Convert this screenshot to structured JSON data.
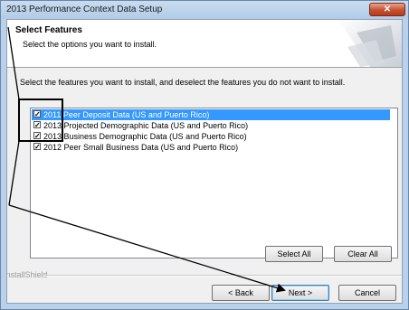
{
  "window": {
    "title": "2013 Performance Context Data Setup",
    "close_glyph": "✕"
  },
  "header": {
    "title": "Select Features",
    "subtitle": "Select the options you want to install."
  },
  "instructions": "Select the features you want to install, and deselect the features you do not want to install.",
  "features": [
    {
      "label": "2011 Peer Deposit Data (US and Puerto Rico)",
      "checked": true,
      "selected": true
    },
    {
      "label": "2013 Projected Demographic Data (US and Puerto Rico)",
      "checked": true,
      "selected": false
    },
    {
      "label": "2013 Business Demographic Data (US and Puerto Rico)",
      "checked": true,
      "selected": false
    },
    {
      "label": "2012 Peer Small Business Data (US and Puerto Rico)",
      "checked": true,
      "selected": false
    }
  ],
  "buttons": {
    "select_all": "Select All",
    "clear_all": "Clear All",
    "back": "< Back",
    "next": "Next >",
    "cancel": "Cancel"
  },
  "branding": "InstallShield",
  "check_glyph": "✓",
  "colors": {
    "selection": "#3399ff",
    "annotation": "#000000"
  }
}
